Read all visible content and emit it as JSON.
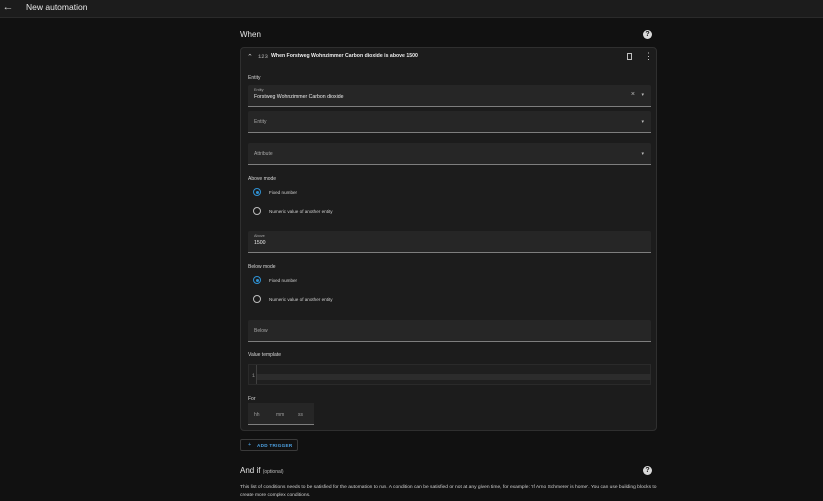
{
  "header": {
    "title": "New automation",
    "back_icon": "arrow-left-icon"
  },
  "when": {
    "title": "When",
    "help_icon": "question-circle-icon",
    "trigger": {
      "type_icon": "123",
      "title": "When Forstweg Wohnzimmer Carbon dioxide is above 1500",
      "entity_section_label": "Entity",
      "entity_field": {
        "label": "Entity",
        "value": "Forstweg Wohnzimmer Carbon dioxide"
      },
      "entity_field_2": {
        "placeholder": "Entity"
      },
      "attribute_field": {
        "placeholder": "Attribute"
      },
      "above_mode": {
        "label": "Above mode",
        "options": [
          "Fixed number",
          "Numeric value of another entity"
        ],
        "selected": "Fixed number"
      },
      "above_field": {
        "label": "Above",
        "value": "1500"
      },
      "below_mode": {
        "label": "Below mode",
        "options": [
          "Fixed number",
          "Numeric value of another entity"
        ],
        "selected": "Fixed number"
      },
      "below_field": {
        "placeholder": "Below"
      },
      "value_template": {
        "label": "Value template",
        "line_number": "1"
      },
      "for": {
        "label": "For",
        "hh": "hh",
        "mm": "mm",
        "ss": "ss"
      }
    },
    "add_trigger_label": "ADD TRIGGER"
  },
  "and_if": {
    "title": "And if",
    "optional": "(optional)",
    "description": "This list of conditions needs to be satisfied for the automation to run. A condition can be satisfied or not at any given time, for example: 'If Arno Schmerer is home'. You can use building blocks to create more complex conditions."
  },
  "colors": {
    "accent": "#2f91d3",
    "link": "#4ea4e6",
    "background": "#111111",
    "card": "#1c1c1c"
  }
}
